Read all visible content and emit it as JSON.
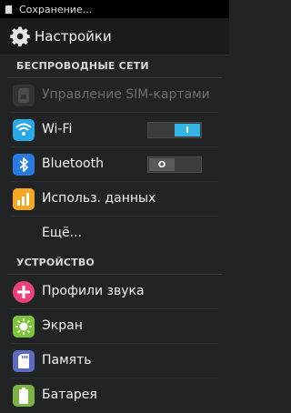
{
  "status_bar": {
    "text": "Сохранение..."
  },
  "action_bar": {
    "title": "Настройки",
    "icon": "gear-icon"
  },
  "sections": {
    "wireless": {
      "label": "БЕСПРОВОДНЫЕ СЕТИ"
    },
    "device": {
      "label": "УСТРОЙСТВО"
    }
  },
  "items": {
    "sim": {
      "label": "Управление SIM-картами",
      "icon": "sim-card-icon",
      "enabled": false
    },
    "wifi": {
      "label": "Wi-Fi",
      "icon": "wifi-icon",
      "toggle": "on",
      "toggle_glyph": "I"
    },
    "bluetooth": {
      "label": "Bluetooth",
      "icon": "bluetooth-icon",
      "toggle": "off",
      "toggle_glyph": "O"
    },
    "data_usage": {
      "label": "Использ. данных",
      "icon": "data-usage-icon"
    },
    "more": {
      "label": "Ещё..."
    },
    "sound_profiles": {
      "label": "Профили звука",
      "icon": "sound-profiles-icon"
    },
    "display": {
      "label": "Экран",
      "icon": "display-icon"
    },
    "storage": {
      "label": "Память",
      "icon": "storage-icon"
    },
    "battery": {
      "label": "Батарея",
      "icon": "battery-icon"
    }
  },
  "colors": {
    "accent": "#33b5e5",
    "wifi_icon": "#29a9e8",
    "bluetooth_icon": "#2a7be0",
    "data_usage_icon": "#f5a623",
    "sound_icon": "#ec407a",
    "display_icon": "#7cc43a",
    "storage_icon": "#5c6bc0",
    "battery_icon": "#7cb342"
  }
}
